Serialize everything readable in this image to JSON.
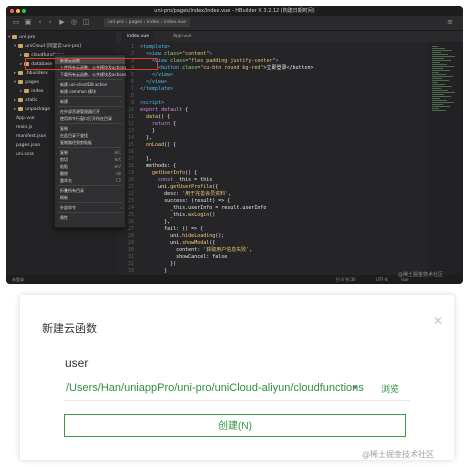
{
  "ide": {
    "window_title": "uni-pro/pages/index/index.vue - HBuilder X 3.2.12 (构建日期时间)",
    "breadcrumbs": "uni-pro › pages › index › index.vue",
    "sidebar": {
      "root": "uni-pro",
      "items": [
        "uniCloud [阿里云:uni-pro]",
        "cloudfunctions",
        "database",
        ".hbuilderx",
        "pages",
        "index",
        "static",
        "unpackage",
        "App.vue",
        "main.js",
        "manifest.json",
        "pages.json",
        "uni.scss"
      ]
    },
    "tabs": [
      "index.vue",
      "App.vue"
    ],
    "code_lines": [
      {
        "n": "1",
        "parts": [
          {
            "c": "c-tag",
            "t": "<template>"
          }
        ]
      },
      {
        "n": "2",
        "parts": [
          {
            "c": "c-tag",
            "t": "  <view "
          },
          {
            "c": "c-attr",
            "t": "class="
          },
          {
            "c": "c-str",
            "t": "\"content\""
          },
          {
            "c": "c-tag",
            "t": ">"
          }
        ]
      },
      {
        "n": "3",
        "parts": [
          {
            "c": "c-tag",
            "t": "    <view "
          },
          {
            "c": "c-attr",
            "t": "class="
          },
          {
            "c": "c-str",
            "t": "\"flex padding justify-center\""
          },
          {
            "c": "c-tag",
            "t": ">"
          }
        ]
      },
      {
        "n": "4",
        "parts": [
          {
            "c": "c-tag",
            "t": "      <button "
          },
          {
            "c": "c-attr",
            "t": "class="
          },
          {
            "c": "c-str",
            "t": "\"cu-btn round bg-red\""
          },
          {
            "c": "c-txt",
            "t": ">立即登录</button>"
          }
        ]
      },
      {
        "n": "5",
        "parts": [
          {
            "c": "c-tag",
            "t": "    </view>"
          }
        ]
      },
      {
        "n": "6",
        "parts": [
          {
            "c": "c-tag",
            "t": "  </view>"
          }
        ]
      },
      {
        "n": "7",
        "parts": [
          {
            "c": "c-tag",
            "t": "</template>"
          }
        ]
      },
      {
        "n": "8",
        "parts": [
          {
            "c": "c-txt",
            "t": ""
          }
        ]
      },
      {
        "n": "9",
        "parts": [
          {
            "c": "c-tag",
            "t": "<script>"
          }
        ]
      },
      {
        "n": "10",
        "parts": [
          {
            "c": "c-kw",
            "t": "export default "
          },
          {
            "c": "c-txt",
            "t": "{"
          }
        ]
      },
      {
        "n": "11",
        "parts": [
          {
            "c": "c-fn",
            "t": "  data"
          },
          {
            "c": "c-txt",
            "t": "() {"
          }
        ]
      },
      {
        "n": "12",
        "parts": [
          {
            "c": "c-kw",
            "t": "    return "
          },
          {
            "c": "c-txt",
            "t": "{"
          }
        ]
      },
      {
        "n": "13",
        "parts": [
          {
            "c": "c-txt",
            "t": "    }"
          }
        ]
      },
      {
        "n": "14",
        "parts": [
          {
            "c": "c-txt",
            "t": "  },"
          }
        ]
      },
      {
        "n": "15",
        "parts": [
          {
            "c": "c-fn",
            "t": "  onLoad"
          },
          {
            "c": "c-txt",
            "t": "() {"
          }
        ]
      },
      {
        "n": "16",
        "parts": [
          {
            "c": "c-txt",
            "t": ""
          }
        ]
      },
      {
        "n": "17",
        "parts": [
          {
            "c": "c-txt",
            "t": "  },"
          }
        ]
      },
      {
        "n": "18",
        "parts": [
          {
            "c": "c-txt",
            "t": "  methods: {"
          }
        ]
      },
      {
        "n": "19",
        "parts": [
          {
            "c": "c-fn",
            "t": "    getUserInfo"
          },
          {
            "c": "c-txt",
            "t": "() {"
          }
        ]
      },
      {
        "n": "20",
        "parts": [
          {
            "c": "c-kw",
            "t": "      const "
          },
          {
            "c": "c-txt",
            "t": "_this = this"
          }
        ]
      },
      {
        "n": "21",
        "parts": [
          {
            "c": "c-txt",
            "t": "      uni."
          },
          {
            "c": "c-fn",
            "t": "getUserProfile"
          },
          {
            "c": "c-txt",
            "t": "({"
          }
        ]
      },
      {
        "n": "22",
        "parts": [
          {
            "c": "c-txt",
            "t": "        desc: "
          },
          {
            "c": "c-str",
            "t": "'用于完善会员资料'"
          },
          {
            "c": "c-txt",
            "t": ","
          }
        ]
      },
      {
        "n": "23",
        "parts": [
          {
            "c": "c-txt",
            "t": "        success: (result) => {"
          }
        ]
      },
      {
        "n": "24",
        "parts": [
          {
            "c": "c-txt",
            "t": "          _this.userInfo = result.userInfo"
          }
        ]
      },
      {
        "n": "25",
        "parts": [
          {
            "c": "c-txt",
            "t": "          _this."
          },
          {
            "c": "c-fn",
            "t": "wxLogin"
          },
          {
            "c": "c-txt",
            "t": "()"
          }
        ]
      },
      {
        "n": "26",
        "parts": [
          {
            "c": "c-txt",
            "t": "        },"
          }
        ]
      },
      {
        "n": "27",
        "parts": [
          {
            "c": "c-txt",
            "t": "        fail: () => {"
          }
        ]
      },
      {
        "n": "28",
        "parts": [
          {
            "c": "c-txt",
            "t": "          uni."
          },
          {
            "c": "c-fn",
            "t": "hideLoading"
          },
          {
            "c": "c-txt",
            "t": "();"
          }
        ]
      },
      {
        "n": "29",
        "parts": [
          {
            "c": "c-txt",
            "t": "          uni."
          },
          {
            "c": "c-fn",
            "t": "showModal"
          },
          {
            "c": "c-txt",
            "t": "({"
          }
        ]
      },
      {
        "n": "30",
        "parts": [
          {
            "c": "c-txt",
            "t": "            content: "
          },
          {
            "c": "c-str",
            "t": "'获取用户信息失败'"
          },
          {
            "c": "c-txt",
            "t": ","
          }
        ]
      },
      {
        "n": "31",
        "parts": [
          {
            "c": "c-txt",
            "t": "            showCancel: false"
          }
        ]
      },
      {
        "n": "32",
        "parts": [
          {
            "c": "c-txt",
            "t": "          })"
          }
        ]
      },
      {
        "n": "33",
        "parts": [
          {
            "c": "c-txt",
            "t": "        }"
          }
        ]
      }
    ],
    "context_menu": {
      "items": [
        {
          "label": "新建云函数",
          "key": "",
          "arrow": false,
          "highlight": true
        },
        {
          "label": "上传所有云函数、公共模块及actions",
          "key": "",
          "arrow": false
        },
        {
          "label": "下载所有云函数、公共模块及actions",
          "key": "",
          "arrow": false
        },
        {
          "sep": true
        },
        {
          "label": "新建 uni-clientDB action",
          "key": "",
          "arrow": false
        },
        {
          "label": "新建 common 模块",
          "key": "",
          "arrow": false
        },
        {
          "sep": true
        },
        {
          "label": "新建",
          "key": "",
          "arrow": true
        },
        {
          "sep": true
        },
        {
          "label": "在外部资源管理器打开",
          "key": "",
          "arrow": false
        },
        {
          "label": "使用命令行窗口打开所在目录",
          "key": "",
          "arrow": false
        },
        {
          "sep": true
        },
        {
          "label": "复制",
          "key": "",
          "arrow": false
        },
        {
          "label": "在此目录下查找",
          "key": "",
          "arrow": false
        },
        {
          "label": "复制路径到剪贴板",
          "key": "",
          "arrow": false
        },
        {
          "sep": true
        },
        {
          "label": "复制",
          "key": "⌘C",
          "arrow": false
        },
        {
          "label": "剪切",
          "key": "⌘X",
          "arrow": false
        },
        {
          "label": "粘贴",
          "key": "⌘V",
          "arrow": false
        },
        {
          "label": "删除",
          "key": "⌫",
          "arrow": false
        },
        {
          "label": "重命名",
          "key": "F2",
          "arrow": false
        },
        {
          "sep": true
        },
        {
          "label": "折叠所有目录",
          "key": "",
          "arrow": false
        },
        {
          "label": "刷新",
          "key": "",
          "arrow": false
        },
        {
          "sep": true
        },
        {
          "label": "外部命令",
          "key": "",
          "arrow": true
        },
        {
          "sep": true
        },
        {
          "label": "属性",
          "key": "",
          "arrow": false
        }
      ]
    },
    "status": {
      "left": "未登录",
      "right": [
        "行:4 列:30",
        "UTF-8",
        "Vue"
      ]
    },
    "watermark": "@稀土掘金技术社区"
  },
  "dialog": {
    "title": "新建云函数",
    "close_icon": "close-icon",
    "name_value": "user",
    "path": "/Users/Han/uniappPro/uni-pro/uniCloud-aliyun/cloudfunctions",
    "browse_label": "浏览",
    "create_label": "创建(N)"
  },
  "watermark": "@稀土掘金技术社区",
  "colors": {
    "accent_green": "#2f8f3f",
    "highlight_red": "#e33a2d",
    "ide_bg": "#252527"
  }
}
